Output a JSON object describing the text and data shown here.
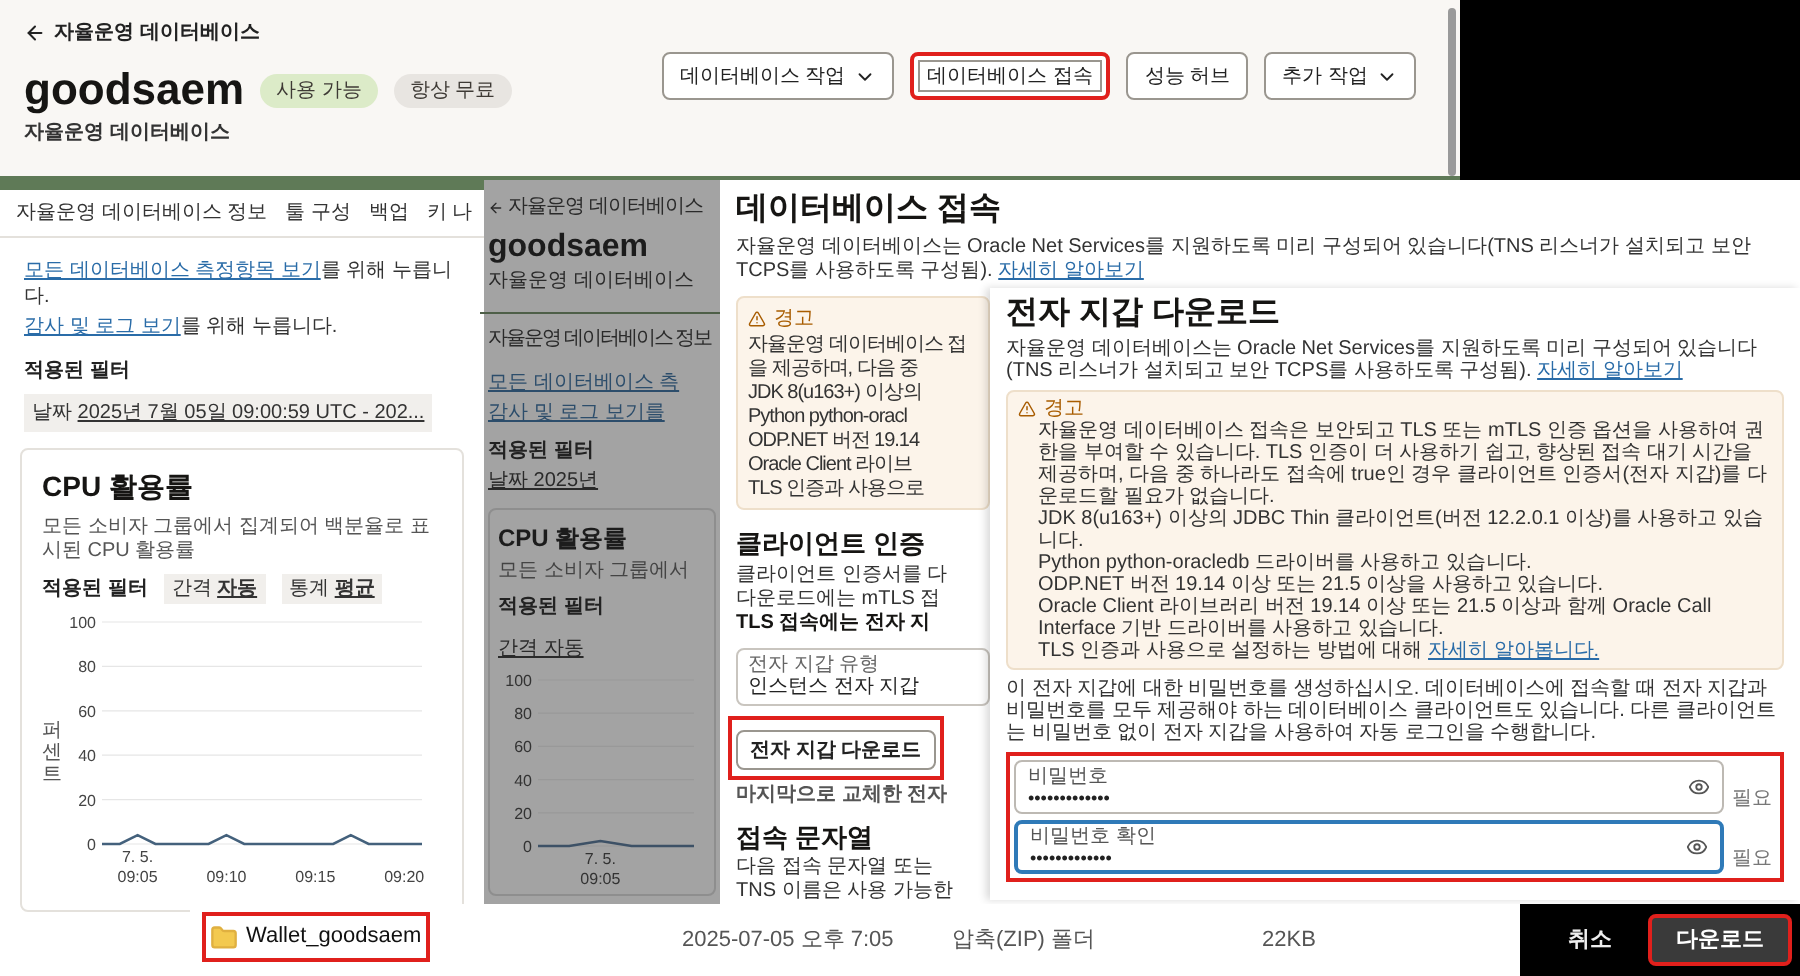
{
  "main_page": {
    "breadcrumb": "자율운영 데이터베이스",
    "title": "goodsaem",
    "badges": [
      {
        "label": "사용 가능",
        "color": "#dcebc8"
      },
      {
        "label": "항상 무료",
        "color": "#e8e5e1"
      }
    ],
    "subtitle": "자율운영 데이터베이스",
    "actions": [
      {
        "label": "데이터베이스 작업",
        "dropdown": true,
        "highlighted": false
      },
      {
        "label": "데이터베이스 접속",
        "dropdown": false,
        "highlighted": true
      },
      {
        "label": "성능 허브",
        "dropdown": false,
        "highlighted": false
      },
      {
        "label": "추가 작업",
        "dropdown": true,
        "highlighted": false
      }
    ],
    "tabs": [
      "자율운영 데이터베이스 정보",
      "툴 구성",
      "백업",
      "키 나"
    ],
    "links": [
      {
        "link": "모든 데이터베이스 측정항목 보기",
        "text": "를 위해 누릅니다."
      },
      {
        "link": "감사 및 로그 보기",
        "text": "를 위해 누릅니다."
      }
    ],
    "filter": {
      "label": "적용된 필터",
      "chip_key": "날짜",
      "chip_value": "2025년 7월 05일 09:00:59 UTC - 202..."
    },
    "cpu_card": {
      "title": "CPU 활용률",
      "description": "모든 소비자 그룹에서 집계되어 백분율로 표시된 CPU 활용률",
      "filter_label": "적용된 필터",
      "chips": [
        {
          "key": "간격",
          "value": "자동"
        },
        {
          "key": "통계",
          "value": "평균"
        }
      ],
      "date_label": "7. 5.",
      "chart_data": {
        "type": "line",
        "grid": true,
        "ylabel": "퍼센트",
        "categories": [
          null,
          null,
          "09:05",
          null,
          null,
          null,
          null,
          "09:10",
          null,
          null,
          null,
          null,
          "09:15",
          null,
          null,
          null,
          null,
          "09:20",
          null
        ],
        "ylim": [
          0,
          100
        ],
        "yticks": [
          0,
          20,
          40,
          60,
          80,
          100
        ],
        "series": [
          {
            "color": "#44617c",
            "values": [
              0,
              0,
              4,
              0,
              0,
              0,
              0,
              4,
              0,
              0,
              0,
              0,
              0,
              0,
              4,
              0,
              0,
              0,
              0
            ]
          }
        ]
      }
    }
  },
  "background_page": {
    "breadcrumb": "자율운영 데이터베이스",
    "title": "goodsaem",
    "subtitle": "자율운영 데이터베이스",
    "tab": "자율운영 데이터베이스 정보",
    "links": [
      "모든 데이터베이스 측",
      "감사 및 로그 보기를"
    ],
    "filter": {
      "label": "적용된 필터",
      "chip": "날짜 2025년"
    },
    "card": {
      "title": "CPU 활용률",
      "description": "모든 소비자 그룹에서",
      "filter_label": "적용된 필터",
      "chip": "간격 자동",
      "date_label": "7. 5.",
      "chart_data": {
        "type": "line",
        "grid": true,
        "categories": [
          null,
          null,
          "09:05",
          null,
          null,
          null
        ],
        "ylim": [
          0,
          100
        ],
        "yticks": [
          0,
          20,
          40,
          60,
          80,
          100
        ],
        "series": [
          {
            "color": "#3d5166",
            "values": [
              0,
              0,
              3,
              0,
              0,
              0
            ]
          }
        ]
      }
    }
  },
  "connect_dialog": {
    "title": "데이터베이스 접속",
    "intro": "자율운영 데이터베이스는 Oracle Net Services를 지원하도록 미리 구성되어 있습니다(TNS 리스너가 설치되고 보안 TCPS를 사용하도록 구성됨).",
    "intro_link": "자세히 알아보기",
    "warning": {
      "title": "경고",
      "lines": [
        "자율운영 데이터베이스 접",
        "을 제공하며, 다음 중",
        "JDK 8(u163+) 이상의",
        "Python python-oracl",
        "ODP.NET 버전 19.14",
        "Oracle Client 라이브",
        "TLS 인증과 사용으로"
      ]
    },
    "client_auth": {
      "heading": "클라이언트 인증",
      "lines": [
        {
          "text": "클라이언트 인증서를 다",
          "bold": false
        },
        {
          "text": "다운로드에는 mTLS 접",
          "bold": false
        },
        {
          "text": "TLS 접속에는 전자 지",
          "bold": true
        }
      ]
    },
    "wallet_type": {
      "label": "전자 지갑 유형",
      "value": "인스턴스 전자 지갑"
    },
    "download_button": {
      "label": "전자 지갑 다운로드",
      "highlighted": true
    },
    "note": "마지막으로 교체한 전자",
    "connection_strings": {
      "heading": "접속 문자열",
      "lines": [
        "다음 접속 문자열 또는",
        "TNS 이름은 사용 가능한"
      ]
    }
  },
  "wallet_dialog": {
    "title": "전자 지갑 다운로드",
    "intro": "자율운영 데이터베이스는 Oracle Net Services를 지원하도록 미리 구성되어 있습니다(TNS 리스너가 설치되고 보안 TCPS를 사용하도록 구성됨).",
    "intro_link": "자세히 알아보기",
    "warning": {
      "title": "경고",
      "text": "자율운영 데이터베이스 접속은 보안되고 TLS 또는 mTLS 인증 옵션을 사용하여 권한을 부여할 수 있습니다. TLS 인증이 더 사용하기 쉽고, 향상된 접속 대기 시간을 제공하며, 다음 중 하나라도 접속에 true인 경우 클라이언트 인증서(전자 지갑)를 다운로드할 필요가 없습니다.",
      "items": [
        {
          "text": "JDK 8(u163+) 이상의 JDBC Thin 클라이언트(버전 12.2.0.1 이상)를 사용하고 있습니다."
        },
        {
          "text": "Python python-oracledb 드라이버를 사용하고 있습니다."
        },
        {
          "text": "ODP.NET 버전 19.14 이상 또는 21.5 이상을 사용하고 있습니다."
        },
        {
          "text": "Oracle Client 라이브러리 버전 19.14 이상 또는 21.5 이상과 함께 Oracle Call Interface 기반 드라이버를 사용하고 있습니다."
        },
        {
          "text": "TLS 인증과 사용으로 설정하는 방법에 대해",
          "link": "자세히 알아봅니다."
        }
      ]
    },
    "description": "이 전자 지갑에 대한 비밀번호를 생성하십시오. 데이터베이스에 접속할 때 전자 지갑과 비밀번호를 모두 제공해야 하는 데이터베이스 클라이언트도 있습니다. 다른 클라이언트는 비밀번호 없이 전자 지갑을 사용하여 자동 로그인을 수행합니다.",
    "fields_highlighted": true,
    "fields": [
      {
        "label": "비밀번호",
        "value": "•••••••••••••",
        "hint": "필요",
        "focused": false
      },
      {
        "label": "비밀번호 확인",
        "value": "•••••••••••••",
        "hint": "필요",
        "focused": true
      }
    ]
  },
  "file_bar": {
    "file_name": "Wallet_goodsaem",
    "file_highlighted": true,
    "modified": "2025-07-05 오후 7:05",
    "type": "압축(ZIP) 폴더",
    "size": "22KB",
    "buttons": [
      {
        "label": "취소",
        "kind": "secondary",
        "highlighted": false
      },
      {
        "label": "다운로드",
        "kind": "primary",
        "highlighted": true
      }
    ]
  }
}
